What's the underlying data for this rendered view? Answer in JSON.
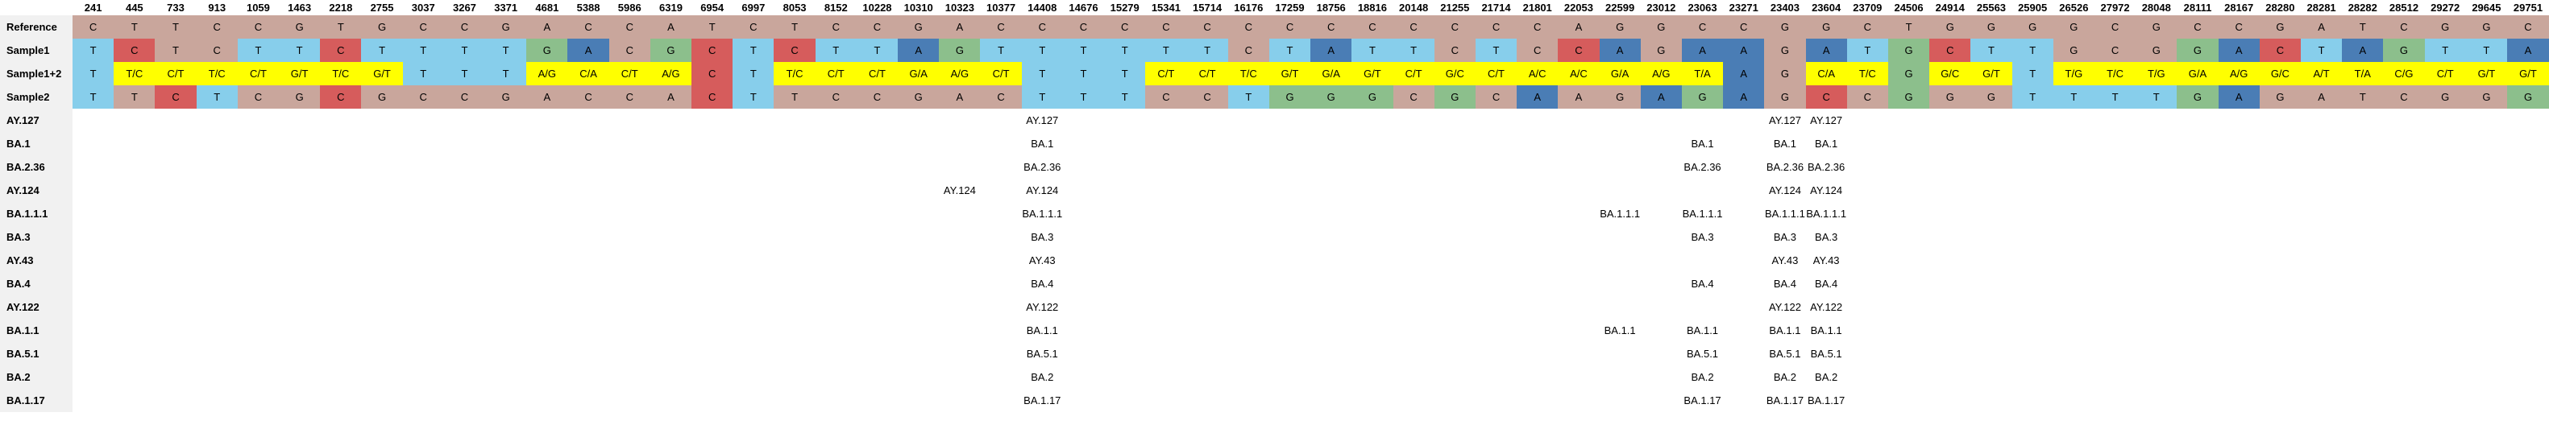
{
  "positions": [
    "241",
    "445",
    "733",
    "913",
    "1059",
    "1463",
    "2218",
    "2755",
    "3037",
    "3267",
    "3371",
    "4681",
    "5388",
    "5986",
    "6319",
    "6954",
    "6997",
    "8053",
    "8152",
    "10228",
    "10310",
    "10323",
    "10377",
    "14408",
    "14676",
    "15279",
    "15341",
    "15714",
    "16176",
    "17259",
    "18756",
    "18816",
    "20148",
    "21255",
    "21714",
    "21801",
    "22053",
    "22599",
    "23012",
    "23063",
    "23271",
    "23403",
    "23604",
    "23709",
    "24506",
    "24914",
    "25563",
    "25905",
    "26526",
    "27972",
    "28048",
    "28111",
    "28167",
    "28280",
    "28281",
    "28282",
    "28512",
    "29272",
    "29645",
    "29751"
  ],
  "colors": {
    "C": "#d65c5c",
    "A": "#4a7db5",
    "G": "#8cbf8c",
    "T": "#87ceeb",
    "ref": "#c9a69c",
    "mixed": "#ffff00"
  },
  "rows": [
    {
      "label": "Reference",
      "type": "ref",
      "cells": [
        "C",
        "T",
        "T",
        "C",
        "C",
        "G",
        "T",
        "G",
        "C",
        "C",
        "G",
        "A",
        "C",
        "C",
        "A",
        "T",
        "C",
        "T",
        "C",
        "C",
        "G",
        "A",
        "C",
        "C",
        "C",
        "C",
        "C",
        "C",
        "C",
        "C",
        "C",
        "C",
        "C",
        "C",
        "C",
        "C",
        "A",
        "G",
        "G",
        "C",
        "C",
        "G",
        "G",
        "C",
        "T",
        "G",
        "G",
        "G",
        "G",
        "C",
        "G",
        "C",
        "C",
        "G",
        "A",
        "T",
        "C",
        "G",
        "G",
        "C"
      ]
    },
    {
      "label": "Sample1",
      "type": "sample",
      "cells": [
        "T",
        "C",
        "T",
        "C",
        "T",
        "T",
        "C",
        "T",
        "T",
        "T",
        "T",
        "G",
        "A",
        "C",
        "G",
        "C",
        "T",
        "C",
        "T",
        "T",
        "A",
        "G",
        "T",
        "T",
        "T",
        "T",
        "T",
        "T",
        "C",
        "T",
        "A",
        "T",
        "T",
        "C",
        "T",
        "C",
        "C",
        "A",
        "G",
        "A",
        "A",
        "G",
        "A",
        "T",
        "G",
        "C",
        "T",
        "T",
        "G",
        "C",
        "G",
        "G",
        "A",
        "C",
        "T",
        "A",
        "G",
        "T",
        "T",
        "A"
      ]
    },
    {
      "label": "Sample1+2",
      "type": "mixed",
      "cells": [
        "T",
        "T/C",
        "C/T",
        "T/C",
        "C/T",
        "G/T",
        "T/C",
        "G/T",
        "T",
        "T",
        "T",
        "A/G",
        "C/A",
        "C/T",
        "A/G",
        "C",
        "T",
        "T/C",
        "C/T",
        "C/T",
        "G/A",
        "A/G",
        "C/T",
        "T",
        "T",
        "T",
        "C/T",
        "C/T",
        "T/C",
        "G/T",
        "G/A",
        "G/T",
        "C/T",
        "G/C",
        "C/T",
        "A/C",
        "A/C",
        "G/A",
        "A/G",
        "T/A",
        "A",
        "G",
        "C/A",
        "T/C",
        "G",
        "G/C",
        "G/T",
        "T",
        "T/G",
        "T/C",
        "T/G",
        "G/A",
        "A/G",
        "G/C",
        "A/T",
        "T/A",
        "C/G",
        "C/T",
        "G/T",
        "G/T"
      ]
    },
    {
      "label": "Sample2",
      "type": "sample",
      "cells": [
        "T",
        "T",
        "C",
        "T",
        "C",
        "G",
        "C",
        "G",
        "C",
        "C",
        "G",
        "A",
        "C",
        "C",
        "A",
        "C",
        "T",
        "T",
        "C",
        "C",
        "G",
        "A",
        "C",
        "T",
        "T",
        "T",
        "C",
        "C",
        "T",
        "G",
        "G",
        "G",
        "C",
        "G",
        "C",
        "A",
        "A",
        "G",
        "A",
        "G",
        "A",
        "G",
        "C",
        "C",
        "G",
        "G",
        "G",
        "T",
        "T",
        "T",
        "T",
        "G",
        "A",
        "G",
        "A",
        "T",
        "C",
        "G",
        "G",
        "G"
      ]
    },
    {
      "label": "AY.127",
      "values": {
        "23": "AY.127",
        "41": "AY.127",
        "42": "AY.127"
      }
    },
    {
      "label": "BA.1",
      "values": {
        "23": "BA.1",
        "39": "BA.1",
        "41": "BA.1",
        "42": "BA.1"
      }
    },
    {
      "label": "BA.2.36",
      "values": {
        "23": "BA.2.36",
        "39": "BA.2.36",
        "41": "BA.2.36",
        "42": "BA.2.36"
      }
    },
    {
      "label": "AY.124",
      "values": {
        "21": "AY.124",
        "23": "AY.124",
        "41": "AY.124",
        "42": "AY.124"
      }
    },
    {
      "label": "BA.1.1.1",
      "values": {
        "23": "BA.1.1.1",
        "37": "BA.1.1.1",
        "39": "BA.1.1.1",
        "41": "BA.1.1.1",
        "42": "BA.1.1.1"
      }
    },
    {
      "label": "BA.3",
      "values": {
        "23": "BA.3",
        "39": "BA.3",
        "41": "BA.3",
        "42": "BA.3"
      }
    },
    {
      "label": "AY.43",
      "values": {
        "23": "AY.43",
        "41": "AY.43",
        "42": "AY.43"
      }
    },
    {
      "label": "BA.4",
      "values": {
        "23": "BA.4",
        "39": "BA.4",
        "41": "BA.4",
        "42": "BA.4"
      }
    },
    {
      "label": "AY.122",
      "values": {
        "23": "AY.122",
        "41": "AY.122",
        "42": "AY.122"
      }
    },
    {
      "label": "BA.1.1",
      "values": {
        "23": "BA.1.1",
        "37": "BA.1.1",
        "39": "BA.1.1",
        "41": "BA.1.1",
        "42": "BA.1.1"
      }
    },
    {
      "label": "BA.5.1",
      "values": {
        "23": "BA.5.1",
        "39": "BA.5.1",
        "41": "BA.5.1",
        "42": "BA.5.1"
      }
    },
    {
      "label": "BA.2",
      "values": {
        "23": "BA.2",
        "39": "BA.2",
        "41": "BA.2",
        "42": "BA.2"
      }
    },
    {
      "label": "BA.1.17",
      "values": {
        "23": "BA.1.17",
        "39": "BA.1.17",
        "41": "BA.1.17",
        "42": "BA.1.17"
      }
    }
  ]
}
